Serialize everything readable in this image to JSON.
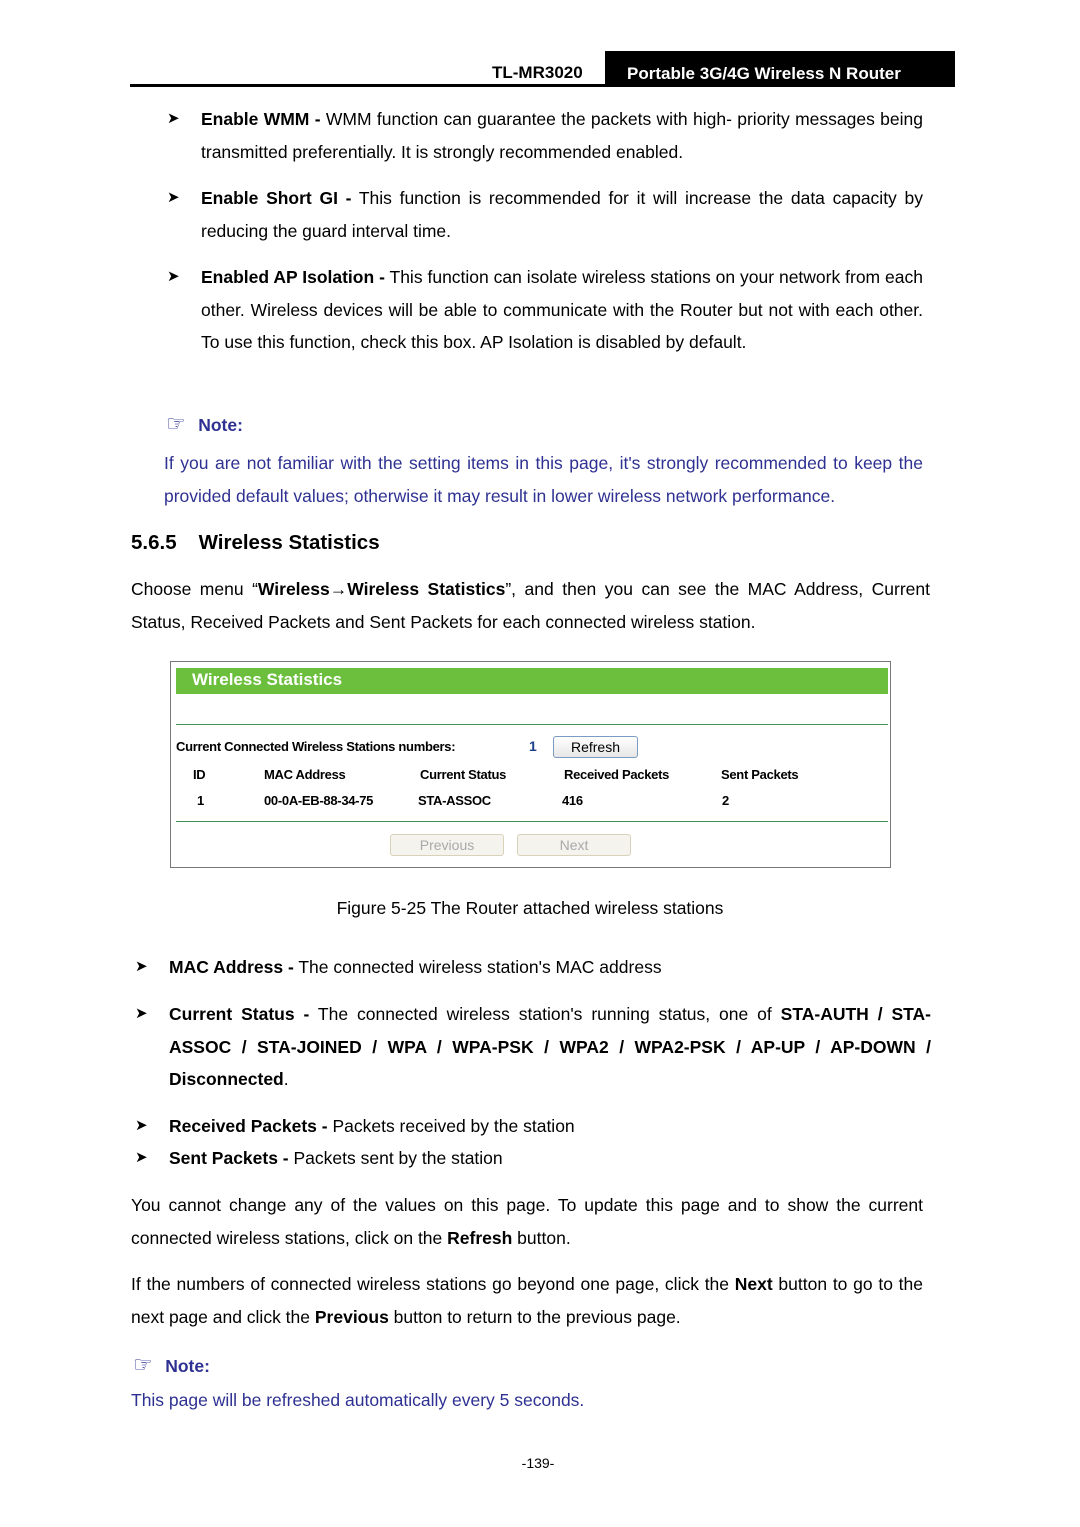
{
  "header": {
    "model": "TL-MR3020",
    "product": "Portable 3G/4G Wireless N Router"
  },
  "bullets_top": [
    {
      "term": "Enable WMM -",
      "text": " WMM function can guarantee the packets with high- priority messages being transmitted preferentially. It is strongly recommended enabled."
    },
    {
      "term": "Enable Short GI -",
      "text": " This function is recommended for it will increase the data capacity by reducing the guard interval time."
    },
    {
      "term": "Enabled AP Isolation -",
      "text": " This function can isolate wireless stations on your network from each other. Wireless devices will be able to communicate with the Router but not with each other. To use this function, check this box. AP Isolation is disabled by default."
    }
  ],
  "note1": {
    "title": "Note:",
    "text": "If you are not familiar with the setting items in this page, it's strongly recommended to keep the provided default values; otherwise it may result in lower wireless network performance."
  },
  "section": {
    "number": "5.6.5",
    "title": "Wireless Statistics"
  },
  "intro": {
    "pre": "Choose menu “",
    "menu": "Wireless→Wireless Statistics",
    "post": "”, and then you can see the MAC Address, Current Status, Received Packets and Sent Packets for each connected wireless station."
  },
  "panel": {
    "title": "Wireless Statistics",
    "stations_label": "Current Connected Wireless Stations numbers:",
    "stations_count": "1",
    "refresh_label": "Refresh",
    "columns": [
      "ID",
      "MAC Address",
      "Current Status",
      "Received Packets",
      "Sent Packets"
    ],
    "rows": [
      [
        "1",
        "00-0A-EB-88-34-75",
        "STA-ASSOC",
        "416",
        "2"
      ]
    ],
    "previous_label": "Previous",
    "next_label": "Next",
    "header_color": "#6cbf3d"
  },
  "caption": "Figure 5-25 The Router attached wireless stations",
  "bullets_mid": [
    {
      "term": "MAC Address -",
      "text": " The connected wireless station's MAC address"
    },
    {
      "term": "Current Status -",
      "text": " The connected wireless station's running status, one of ",
      "bold_tail": "STA-AUTH / STA-ASSOC / STA-JOINED / WPA / WPA-PSK / WPA2 / WPA2-PSK / AP-UP / AP-DOWN / Disconnected",
      "end": "."
    },
    {
      "term": "Received Packets -",
      "text": " Packets received by the station"
    },
    {
      "term": "Sent Packets -",
      "text": " Packets sent by the station"
    }
  ],
  "para_refresh": {
    "pre": "You cannot change any of the values on this page. To update this page and to show the current connected wireless stations, click on the ",
    "bold": "Refresh",
    "post": " button."
  },
  "para_next": {
    "pre": "If the numbers of connected wireless stations go beyond one page, click the ",
    "bold1": "Next",
    "mid": " button to go to the next page and click the ",
    "bold2": "Previous",
    "post": " button to return to the previous page."
  },
  "note2": {
    "title": "Note:",
    "text": "This page will be refreshed automatically every 5 seconds."
  },
  "page_number": "-139-",
  "colors": {
    "note_blue": "#2e3192",
    "header_black": "#000000"
  }
}
